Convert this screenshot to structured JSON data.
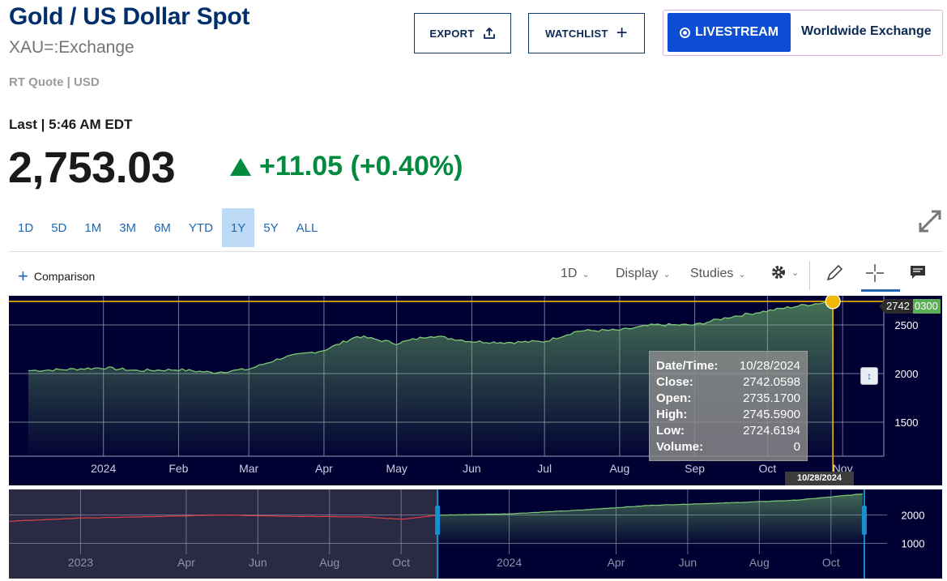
{
  "header": {
    "title": "Gold / US Dollar Spot",
    "symbol": "XAU=:Exchange",
    "quote_type": "RT Quote | USD",
    "last_label": "Last | 5:46 AM EDT",
    "price": "2,753.03",
    "change": "+11.05 (+0.40%)"
  },
  "buttons": {
    "export": "EXPORT",
    "watchlist": "WATCHLIST",
    "livestream": "LIVESTREAM",
    "worldwide": "Worldwide Exchange"
  },
  "ranges": [
    {
      "label": "1D"
    },
    {
      "label": "5D"
    },
    {
      "label": "1M"
    },
    {
      "label": "3M"
    },
    {
      "label": "6M"
    },
    {
      "label": "YTD"
    },
    {
      "label": "1Y",
      "active": true
    },
    {
      "label": "5Y"
    },
    {
      "label": "ALL"
    }
  ],
  "toolbar": {
    "comparison": "Comparison",
    "interval": "1D",
    "display": "Display",
    "studies": "Studies"
  },
  "tooltip": {
    "datetime_label": "Date/Time:",
    "datetime": "10/28/2024",
    "close_label": "Close:",
    "close": "2742.0598",
    "open_label": "Open:",
    "open": "2735.1700",
    "high_label": "High:",
    "high": "2745.5900",
    "low_label": "Low:",
    "low": "2724.6194",
    "volume_label": "Volume:",
    "volume": "0"
  },
  "crosshair": {
    "date_tag": "10/28/2024",
    "price_tag": "2742",
    "price_tag_extra": "0300"
  },
  "colors": {
    "chart_bg": "#000032",
    "line": "#7ecb74",
    "crosshair": "#f2b705",
    "up": "#028a3f",
    "brand": "#002f6c",
    "live": "#0c4dd3"
  },
  "chart_data": [
    {
      "type": "area",
      "name": "main",
      "x_ticks": [
        "2024",
        "Feb",
        "Mar",
        "Apr",
        "May",
        "Jun",
        "Jul",
        "Aug",
        "Sep",
        "Oct",
        "Nov"
      ],
      "y_ticks": [
        1500,
        2000,
        2500
      ],
      "ylim": [
        1150,
        2800
      ],
      "grid": true,
      "x": [
        "2023-12-01",
        "2023-12-15",
        "2024-01-01",
        "2024-01-15",
        "2024-02-01",
        "2024-02-15",
        "2024-03-01",
        "2024-03-15",
        "2024-04-01",
        "2024-04-15",
        "2024-05-01",
        "2024-05-15",
        "2024-06-01",
        "2024-06-15",
        "2024-07-01",
        "2024-07-15",
        "2024-08-01",
        "2024-08-15",
        "2024-09-01",
        "2024-09-15",
        "2024-10-01",
        "2024-10-15",
        "2024-10-28"
      ],
      "values": [
        2030,
        2040,
        2060,
        2030,
        2040,
        2010,
        2045,
        2165,
        2240,
        2385,
        2310,
        2390,
        2330,
        2320,
        2330,
        2440,
        2445,
        2500,
        2500,
        2580,
        2645,
        2700,
        2742
      ]
    },
    {
      "type": "area",
      "name": "navigator",
      "x_ticks": [
        "2023",
        "Apr",
        "Jun",
        "Aug",
        "Oct",
        "2024",
        "Apr",
        "Jun",
        "Aug",
        "Oct"
      ],
      "y_ticks": [
        1000,
        2000
      ],
      "ylim": [
        900,
        2900
      ],
      "grid": true,
      "x": [
        "2022-11-01",
        "2023-01-01",
        "2023-03-01",
        "2023-05-01",
        "2023-07-01",
        "2023-09-01",
        "2023-10-01",
        "2023-11-01",
        "2024-01-01",
        "2024-03-01",
        "2024-05-01",
        "2024-07-01",
        "2024-09-01",
        "2024-10-28"
      ],
      "values": [
        1780,
        1890,
        1940,
        2000,
        1950,
        1930,
        1850,
        1990,
        2040,
        2170,
        2340,
        2420,
        2520,
        2742
      ]
    }
  ]
}
